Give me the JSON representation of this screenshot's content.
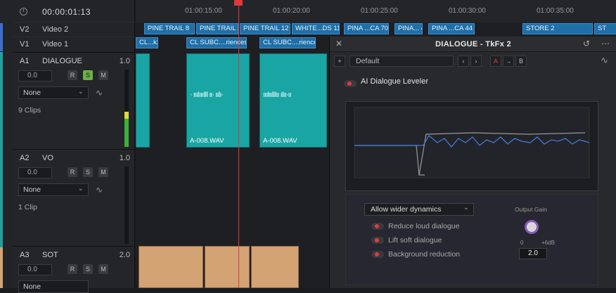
{
  "timecode": "00:00:01:13",
  "ruler": {
    "labels": [
      "01:00:15:00",
      "01:00:20:00",
      "01:00:25:00",
      "01:00:30:00",
      "01:00:35:00"
    ]
  },
  "video_tracks": [
    {
      "id": "V2",
      "name": "Video 2",
      "color": "#3b6ed1",
      "clips": [
        "PINE TRAIL 8",
        "PINE TRAIL 5",
        "PINE TRAIL 12",
        "WHITE...DS 11",
        "PINA ...CA 70",
        "PINA... 48",
        "PINA ...CA 44",
        "STORE 2",
        "",
        "ST"
      ]
    },
    {
      "id": "V1",
      "name": "Video 1",
      "color": "#3b6ed1",
      "clips": [
        "CL...k2",
        "CL SUBC....riences",
        "CL SUBC....riences"
      ]
    }
  ],
  "audio_tracks": [
    {
      "id": "A1",
      "name": "DIALOGUE",
      "vol": "1.0",
      "db": "0.0",
      "preset": "None",
      "clips_text": "9 Clips",
      "solo": true,
      "clip_labels": [
        "A-008.WAV",
        "A-008.WAV"
      ]
    },
    {
      "id": "A2",
      "name": "VO",
      "vol": "1.0",
      "db": "0.0",
      "preset": "None",
      "clips_text": "1 Clip",
      "solo": false
    },
    {
      "id": "A3",
      "name": "SOT",
      "vol": "2.0",
      "db": "0.0",
      "preset": "None",
      "clips_text": "",
      "solo": false
    }
  ],
  "buttons": {
    "r": "R",
    "s": "S",
    "m": "M"
  },
  "panel": {
    "title": "DIALOGUE - TkFx 2",
    "preset": "Default",
    "a": "A",
    "b": "B",
    "plugin": "AI Dialogue Leveler",
    "mode": "Allow wider dynamics",
    "options": [
      "Reduce loud dialogue",
      "Lift soft dialogue",
      "Background reduction"
    ],
    "gain_label": "Output Gain",
    "gain_min": "0",
    "gain_max": "+6dB",
    "gain_value": "2.0"
  },
  "colors": {
    "accent": "#e23b3b",
    "clip_teal": "#19a5a3",
    "clip_blue": "#1f6fa8",
    "sot_clip": "#d4a373"
  }
}
